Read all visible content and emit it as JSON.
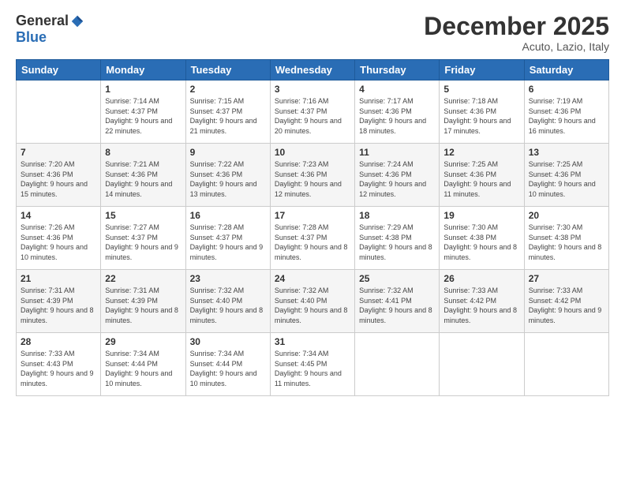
{
  "header": {
    "logo_general": "General",
    "logo_blue": "Blue",
    "title": "December 2025",
    "location": "Acuto, Lazio, Italy"
  },
  "days_of_week": [
    "Sunday",
    "Monday",
    "Tuesday",
    "Wednesday",
    "Thursday",
    "Friday",
    "Saturday"
  ],
  "weeks": [
    [
      {
        "day": "",
        "sunrise": "",
        "sunset": "",
        "daylight": ""
      },
      {
        "day": "1",
        "sunrise": "Sunrise: 7:14 AM",
        "sunset": "Sunset: 4:37 PM",
        "daylight": "Daylight: 9 hours and 22 minutes."
      },
      {
        "day": "2",
        "sunrise": "Sunrise: 7:15 AM",
        "sunset": "Sunset: 4:37 PM",
        "daylight": "Daylight: 9 hours and 21 minutes."
      },
      {
        "day": "3",
        "sunrise": "Sunrise: 7:16 AM",
        "sunset": "Sunset: 4:37 PM",
        "daylight": "Daylight: 9 hours and 20 minutes."
      },
      {
        "day": "4",
        "sunrise": "Sunrise: 7:17 AM",
        "sunset": "Sunset: 4:36 PM",
        "daylight": "Daylight: 9 hours and 18 minutes."
      },
      {
        "day": "5",
        "sunrise": "Sunrise: 7:18 AM",
        "sunset": "Sunset: 4:36 PM",
        "daylight": "Daylight: 9 hours and 17 minutes."
      },
      {
        "day": "6",
        "sunrise": "Sunrise: 7:19 AM",
        "sunset": "Sunset: 4:36 PM",
        "daylight": "Daylight: 9 hours and 16 minutes."
      }
    ],
    [
      {
        "day": "7",
        "sunrise": "Sunrise: 7:20 AM",
        "sunset": "Sunset: 4:36 PM",
        "daylight": "Daylight: 9 hours and 15 minutes."
      },
      {
        "day": "8",
        "sunrise": "Sunrise: 7:21 AM",
        "sunset": "Sunset: 4:36 PM",
        "daylight": "Daylight: 9 hours and 14 minutes."
      },
      {
        "day": "9",
        "sunrise": "Sunrise: 7:22 AM",
        "sunset": "Sunset: 4:36 PM",
        "daylight": "Daylight: 9 hours and 13 minutes."
      },
      {
        "day": "10",
        "sunrise": "Sunrise: 7:23 AM",
        "sunset": "Sunset: 4:36 PM",
        "daylight": "Daylight: 9 hours and 12 minutes."
      },
      {
        "day": "11",
        "sunrise": "Sunrise: 7:24 AM",
        "sunset": "Sunset: 4:36 PM",
        "daylight": "Daylight: 9 hours and 12 minutes."
      },
      {
        "day": "12",
        "sunrise": "Sunrise: 7:25 AM",
        "sunset": "Sunset: 4:36 PM",
        "daylight": "Daylight: 9 hours and 11 minutes."
      },
      {
        "day": "13",
        "sunrise": "Sunrise: 7:25 AM",
        "sunset": "Sunset: 4:36 PM",
        "daylight": "Daylight: 9 hours and 10 minutes."
      }
    ],
    [
      {
        "day": "14",
        "sunrise": "Sunrise: 7:26 AM",
        "sunset": "Sunset: 4:36 PM",
        "daylight": "Daylight: 9 hours and 10 minutes."
      },
      {
        "day": "15",
        "sunrise": "Sunrise: 7:27 AM",
        "sunset": "Sunset: 4:37 PM",
        "daylight": "Daylight: 9 hours and 9 minutes."
      },
      {
        "day": "16",
        "sunrise": "Sunrise: 7:28 AM",
        "sunset": "Sunset: 4:37 PM",
        "daylight": "Daylight: 9 hours and 9 minutes."
      },
      {
        "day": "17",
        "sunrise": "Sunrise: 7:28 AM",
        "sunset": "Sunset: 4:37 PM",
        "daylight": "Daylight: 9 hours and 8 minutes."
      },
      {
        "day": "18",
        "sunrise": "Sunrise: 7:29 AM",
        "sunset": "Sunset: 4:38 PM",
        "daylight": "Daylight: 9 hours and 8 minutes."
      },
      {
        "day": "19",
        "sunrise": "Sunrise: 7:30 AM",
        "sunset": "Sunset: 4:38 PM",
        "daylight": "Daylight: 9 hours and 8 minutes."
      },
      {
        "day": "20",
        "sunrise": "Sunrise: 7:30 AM",
        "sunset": "Sunset: 4:38 PM",
        "daylight": "Daylight: 9 hours and 8 minutes."
      }
    ],
    [
      {
        "day": "21",
        "sunrise": "Sunrise: 7:31 AM",
        "sunset": "Sunset: 4:39 PM",
        "daylight": "Daylight: 9 hours and 8 minutes."
      },
      {
        "day": "22",
        "sunrise": "Sunrise: 7:31 AM",
        "sunset": "Sunset: 4:39 PM",
        "daylight": "Daylight: 9 hours and 8 minutes."
      },
      {
        "day": "23",
        "sunrise": "Sunrise: 7:32 AM",
        "sunset": "Sunset: 4:40 PM",
        "daylight": "Daylight: 9 hours and 8 minutes."
      },
      {
        "day": "24",
        "sunrise": "Sunrise: 7:32 AM",
        "sunset": "Sunset: 4:40 PM",
        "daylight": "Daylight: 9 hours and 8 minutes."
      },
      {
        "day": "25",
        "sunrise": "Sunrise: 7:32 AM",
        "sunset": "Sunset: 4:41 PM",
        "daylight": "Daylight: 9 hours and 8 minutes."
      },
      {
        "day": "26",
        "sunrise": "Sunrise: 7:33 AM",
        "sunset": "Sunset: 4:42 PM",
        "daylight": "Daylight: 9 hours and 8 minutes."
      },
      {
        "day": "27",
        "sunrise": "Sunrise: 7:33 AM",
        "sunset": "Sunset: 4:42 PM",
        "daylight": "Daylight: 9 hours and 9 minutes."
      }
    ],
    [
      {
        "day": "28",
        "sunrise": "Sunrise: 7:33 AM",
        "sunset": "Sunset: 4:43 PM",
        "daylight": "Daylight: 9 hours and 9 minutes."
      },
      {
        "day": "29",
        "sunrise": "Sunrise: 7:34 AM",
        "sunset": "Sunset: 4:44 PM",
        "daylight": "Daylight: 9 hours and 10 minutes."
      },
      {
        "day": "30",
        "sunrise": "Sunrise: 7:34 AM",
        "sunset": "Sunset: 4:44 PM",
        "daylight": "Daylight: 9 hours and 10 minutes."
      },
      {
        "day": "31",
        "sunrise": "Sunrise: 7:34 AM",
        "sunset": "Sunset: 4:45 PM",
        "daylight": "Daylight: 9 hours and 11 minutes."
      },
      {
        "day": "",
        "sunrise": "",
        "sunset": "",
        "daylight": ""
      },
      {
        "day": "",
        "sunrise": "",
        "sunset": "",
        "daylight": ""
      },
      {
        "day": "",
        "sunrise": "",
        "sunset": "",
        "daylight": ""
      }
    ]
  ]
}
